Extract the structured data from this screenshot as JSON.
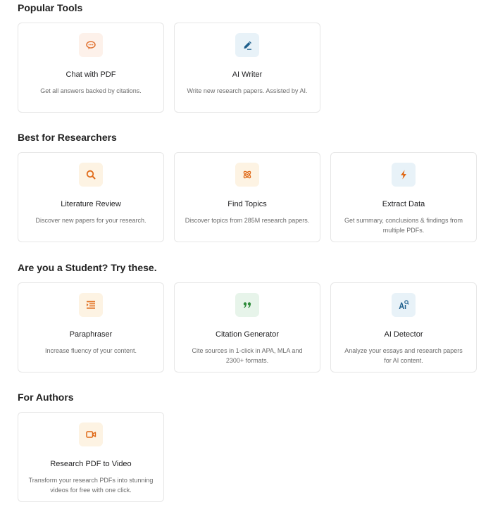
{
  "sections": [
    {
      "title": "Popular Tools",
      "cards": [
        {
          "title": "Chat with PDF",
          "description": "Get all answers backed by citations.",
          "icon": "chat-icon",
          "icon_bg": "#fdf1ea",
          "icon_color": "#e0702e"
        },
        {
          "title": "AI Writer",
          "description": "Write new research papers. Assisted by AI.",
          "icon": "pen-icon",
          "icon_bg": "#e8f2f8",
          "icon_color": "#1e5f8c"
        }
      ]
    },
    {
      "title": "Best for Researchers",
      "cards": [
        {
          "title": "Literature Review",
          "description": "Discover new papers for your research.",
          "icon": "search-icon",
          "icon_bg": "#fdf3e3",
          "icon_color": "#e06a18"
        },
        {
          "title": "Find Topics",
          "description": "Discover topics from 285M research papers.",
          "icon": "atom-icon",
          "icon_bg": "#fdf3e3",
          "icon_color": "#e06a18"
        },
        {
          "title": "Extract Data",
          "description": "Get summary, conclusions & findings from multiple PDFs.",
          "icon": "lightning-icon",
          "icon_bg": "#e8f2f8",
          "icon_color": "#e06a18"
        }
      ]
    },
    {
      "title": "Are you a Student? Try these.",
      "cards": [
        {
          "title": "Paraphraser",
          "description": "Increase fluency of your content.",
          "icon": "list-icon",
          "icon_bg": "#fdf3e3",
          "icon_color": "#e06a18"
        },
        {
          "title": "Citation Generator",
          "description": "Cite sources in 1-click in APA, MLA and 2300+ formats.",
          "icon": "quote-icon",
          "icon_bg": "#e7f4ea",
          "icon_color": "#2e8b3a"
        },
        {
          "title": "AI Detector",
          "description": "Analyze your essays and research papers for AI content.",
          "icon": "ai-detector-icon",
          "icon_bg": "#e8f2f8",
          "icon_color": "#1e5f8c"
        }
      ]
    },
    {
      "title": "For Authors",
      "cards": [
        {
          "title": "Research PDF to Video",
          "description": "Transform your research PDFs into stunning videos for free with one click.",
          "icon": "video-icon",
          "icon_bg": "#fdf3e3",
          "icon_color": "#e06a18"
        }
      ]
    }
  ]
}
